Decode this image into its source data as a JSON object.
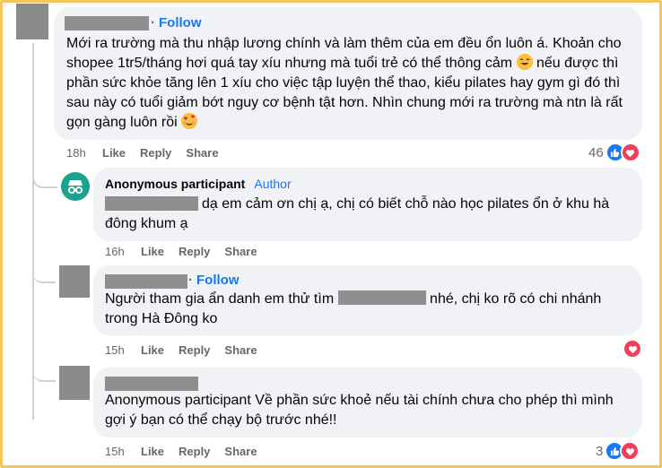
{
  "comments": [
    {
      "text": "Mới ra trường mà thu nhập lương chính và làm thêm của em đều ổn luôn á. Khoản cho shopee 1tr5/tháng hơi quá tay xíu nhưng mà tuổi trẻ có thể thông cảm",
      "text_after_emoji": " nếu được thì phần sức khỏe tăng lên 1 xíu cho việc tập luyện thể thao, kiểu pilates hay gym gì đó thì sau này có tuổi giảm bớt nguy cơ bệnh tật hơn. Nhìn chung mới ra trường mà ntn là rất gọn gàng luôn rồi",
      "follow": "Follow",
      "time": "18h",
      "reaction_count": "46"
    },
    {
      "author": "Anonymous participant",
      "badge": "Author",
      "text": "dạ em cảm ơn chị ạ, chị có biết chỗ nào học pilates ổn ở khu hà đông khum ạ",
      "time": "16h"
    },
    {
      "follow": "Follow",
      "text_prefix": "Người tham gia ẩn danh em thử tìm",
      "text_suffix": "nhé, chị ko rõ có chi nhánh trong Hà Đông ko",
      "time": "15h"
    },
    {
      "text": "Anonymous participant Về phần sức khoẻ nếu tài chính chưa cho phép thì mình gợi ý bạn có thể chạy bộ trước nhé!!",
      "time": "15h",
      "reaction_count": "3"
    }
  ],
  "actions": {
    "like": "Like",
    "reply": "Reply",
    "share": "Share"
  },
  "colors": {
    "bubble": "#f0f2f5",
    "link_blue": "#1877f2",
    "meta_gray": "#65676b",
    "love_red": "#f33e58",
    "frame": "#f2c65a"
  },
  "icons": [
    "like-reaction-icon",
    "love-reaction-icon",
    "incognito-icon",
    "smile-emoji",
    "love-face-emoji"
  ]
}
